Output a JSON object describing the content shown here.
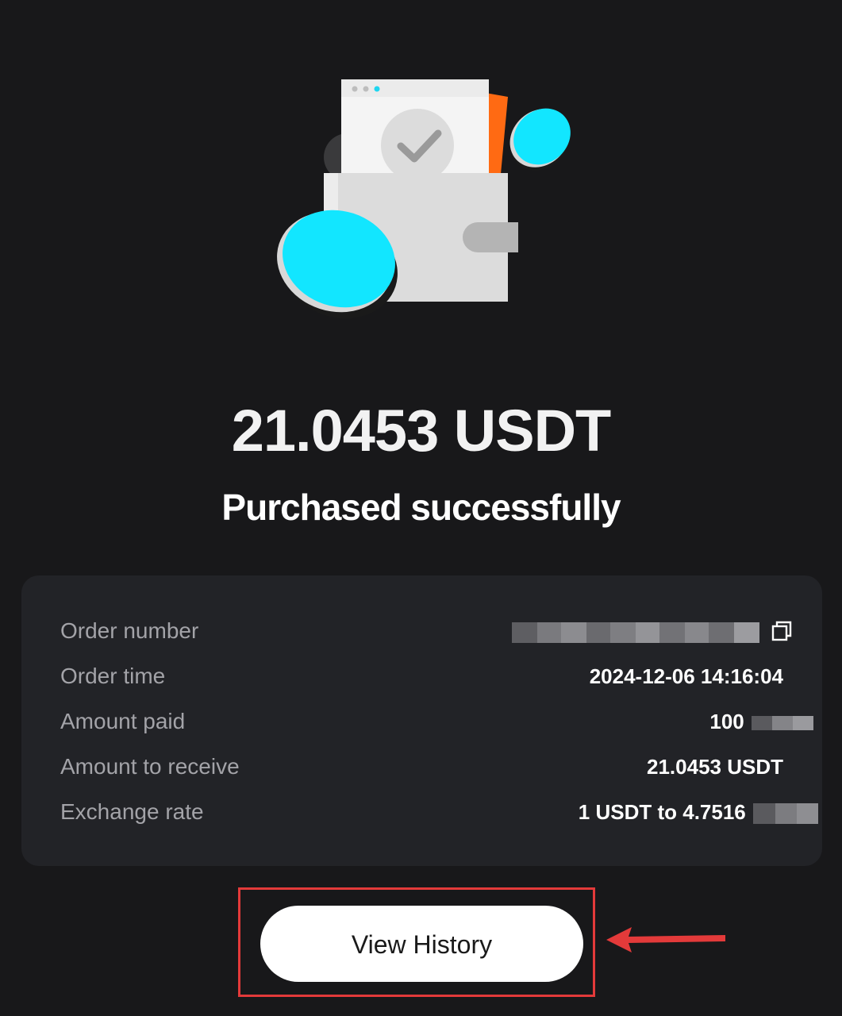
{
  "success": {
    "amount": "21.0453 USDT",
    "status": "Purchased successfully"
  },
  "details": [
    {
      "label": "Order number",
      "value": "",
      "redacted": true,
      "copy_icon": "copy-icon"
    },
    {
      "label": "Order time",
      "value": "2024-12-06 14:16:04"
    },
    {
      "label": "Amount paid",
      "value": "100",
      "redacted_suffix": true
    },
    {
      "label": "Amount to receive",
      "value": "21.0453 USDT"
    },
    {
      "label": "Exchange rate",
      "value": "1 USDT to 4.7516",
      "redacted_suffix": true
    }
  ],
  "actions": {
    "view_history_label": "View History"
  },
  "colors": {
    "background": "#18181a",
    "card": "#222327",
    "accent_coin": "#12e6ff",
    "annotation": "#e33a3a"
  }
}
